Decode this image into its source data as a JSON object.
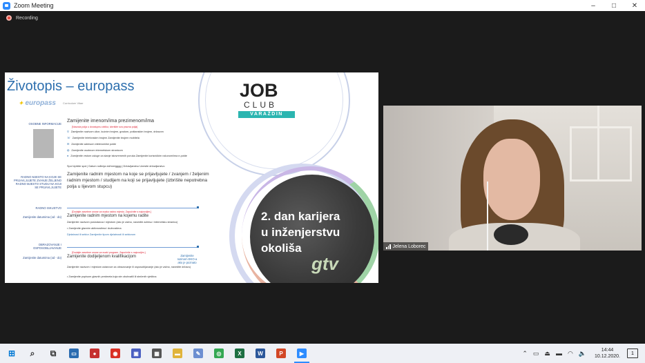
{
  "window": {
    "title": "Zoom Meeting",
    "minimize_label": "–",
    "maximize_label": "□",
    "close_label": "✕"
  },
  "recording": {
    "label": "Recording",
    "color": "#e8493c"
  },
  "slide": {
    "title": "Životopis – europass",
    "logo_text": "europass",
    "cv_label": "Curriculum Vitae",
    "sections": {
      "personal": "OSOBNE INFORMACIJE",
      "position": "RADNO MJESTO NA KOJE SE PRIJAVLJUJETE ZVANJE ŽELJENO RADNO MJESTO STUDIJ NA KOJI SE PRIJAVLJUJETE",
      "experience": "RADNO ISKUSTVO",
      "dates1": "Zamijenite datumima (od - do)",
      "education": "OBRAZOVANJE I OSPOSOBLJAVANJE",
      "dates2": "Zamijenite datumima (od - do)"
    },
    "cv_name": "Zamijenite imenom/ima prezimenom/ima",
    "cv_red_note": "[Navoda polja u dvostupnu obliku; izbrišite sva prazna polja]",
    "contact_lines": [
      "Zamijenite nazivom ulice, kućnim brojem, gradom, poštanskim brojem, državom",
      "Zamijenite telefonskim brojem   Zamijenite brojem mobitela",
      "Zamijenite adresom elektroničke pošte",
      "Zamijenite osobnom internetskom stranicom",
      "Zamijenite vrstom usluge za slanje istovremenih poruka Zamijenite korisničkim računom/ima e-pošte"
    ],
    "personal_line": "Spol Upišite spol | Datum rođenja dd/mm/gggg | Državljanstvo Unesite državljanstvo",
    "position_text": "Zamijenite radnim mjestom na koje se prijavljujete / zvanjem / željenim radnim mjestom / studijem na koji se prijavljujete (izbrišite nepotrebna polja u lijevom stupcu)",
    "exp_red": "[Dodajte zasebne unose za svako radno mjesto. Započnite s najnovijim.]",
    "exp_title": "Zamijenite radnim mjestom na kojemu radite",
    "exp_lines": [
      "Zamijenite nazivom poslodavca i mjestom (ako je važno, navedite adresu i internetsku stranicu)",
      "• Zamijenite glavnim aktivnostima i dužnostima",
      "Djelatnost ili sektor Zamijenite tipom djelatnosti ili sektorom"
    ],
    "edu_red": "[Dodajte zasebne unose za svaki program. Započnite s najnovijim.]",
    "edu_title": "Zamijenite dodijeljenom kvalifikacijom",
    "edu_right": "Zamijenite razinom EKO-a ako je poznato",
    "edu_lines": [
      "Zamijenite nazivom i mjestom ustanove za obrazovanje ili osposobljavanje (ako je važno, navedite državu)",
      "• Zamijenite popisom glavnih predmeta koja ste obuhvatili ili stečenih vještina"
    ],
    "jobclub": {
      "word": "JOB",
      "club": "CLUB",
      "city": "VARAŽDIN"
    },
    "event_lines": [
      "2. dan karijera",
      "u inženjerstvu",
      "okoliša"
    ],
    "gtv": "gtv"
  },
  "video": {
    "participant": "Jelena Loborec"
  },
  "taskbar": {
    "time": "14:44",
    "date": "10.12.2020.",
    "notification_count": "1",
    "apps": [
      {
        "name": "start-button",
        "glyph": "⊞",
        "color": "#0078d4"
      },
      {
        "name": "search-button",
        "glyph": "⌕",
        "color": "#333333"
      },
      {
        "name": "task-view-button",
        "glyph": "⧉",
        "color": "#333333"
      },
      {
        "name": "app-desktop",
        "glyph": "▭",
        "color": "#2b6cb0"
      },
      {
        "name": "app-stop",
        "glyph": "●",
        "color": "#c53030"
      },
      {
        "name": "app-chrome-red",
        "glyph": "◉",
        "color": "#d93025"
      },
      {
        "name": "app-drawing",
        "glyph": "▣",
        "color": "#4a5fc1"
      },
      {
        "name": "app-calculator",
        "glyph": "▦",
        "color": "#555555"
      },
      {
        "name": "app-explorer",
        "glyph": "▬",
        "color": "#e0b43b"
      },
      {
        "name": "app-paint",
        "glyph": "✎",
        "color": "#6d8fd1"
      },
      {
        "name": "app-chrome",
        "glyph": "◎",
        "color": "#34a853"
      },
      {
        "name": "app-excel",
        "glyph": "X",
        "color": "#1d6f42"
      },
      {
        "name": "app-word",
        "glyph": "W",
        "color": "#2b579a"
      },
      {
        "name": "app-powerpoint",
        "glyph": "P",
        "color": "#d24726"
      },
      {
        "name": "app-zoom",
        "glyph": "▶",
        "color": "#2d8cff"
      }
    ]
  }
}
